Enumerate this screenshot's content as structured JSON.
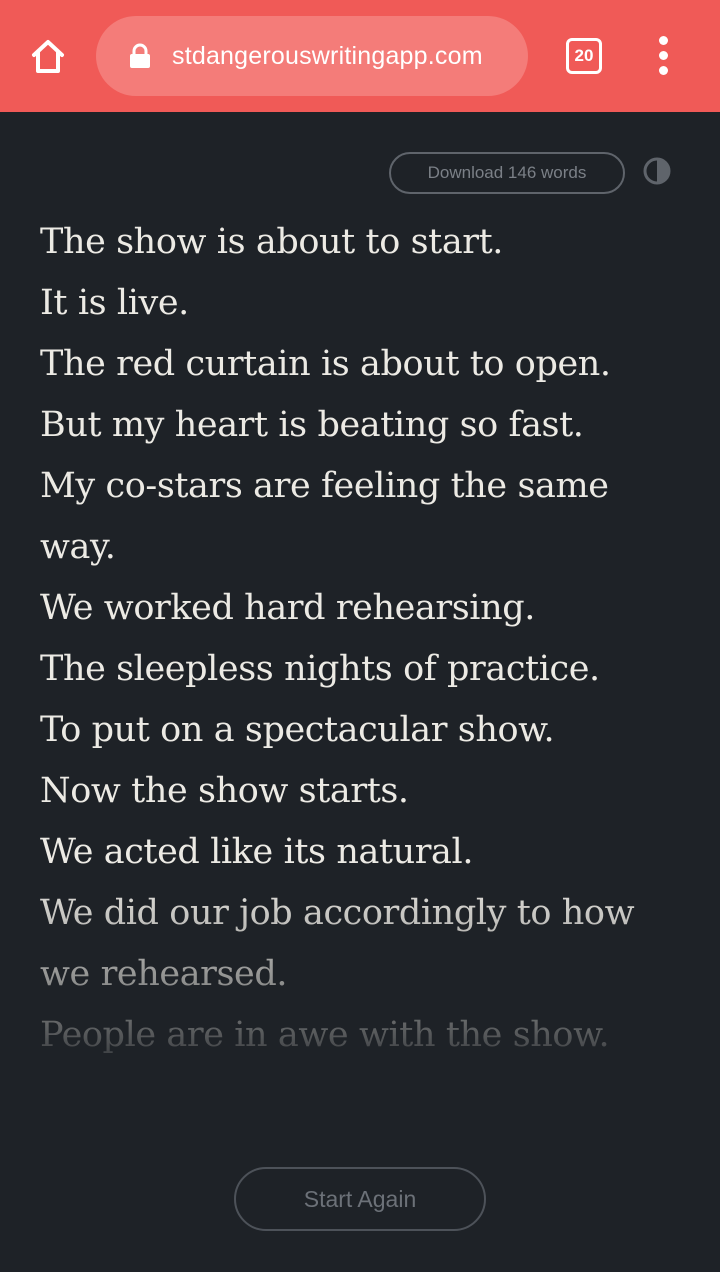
{
  "browser": {
    "url": "stdangerouswritingapp.com",
    "tab_count": "20",
    "bar_color": "#f05a57",
    "icons": [
      "home-icon",
      "lock-icon",
      "tab-switcher",
      "more-vert-icon"
    ]
  },
  "toolbar": {
    "download_label": "Download 146 words",
    "theme_toggle_icon": "contrast-icon"
  },
  "writing": {
    "lines": [
      "The show is about to start.",
      "It is live.",
      "The red curtain is about to open.",
      "But my heart is beating so fast.",
      "My co-stars are feeling the same",
      "way.",
      "We worked hard rehearsing.",
      "The sleepless nights of practice.",
      "To put on a spectacular show.",
      "Now the show starts.",
      "We acted like its natural.",
      "We did our job accordingly to how",
      "we rehearsed.",
      "People are in awe with the show."
    ]
  },
  "footer": {
    "start_again_label": "Start Again"
  },
  "colors": {
    "background": "#1e2227",
    "text": "#eceae4",
    "muted": "#6c7178"
  }
}
